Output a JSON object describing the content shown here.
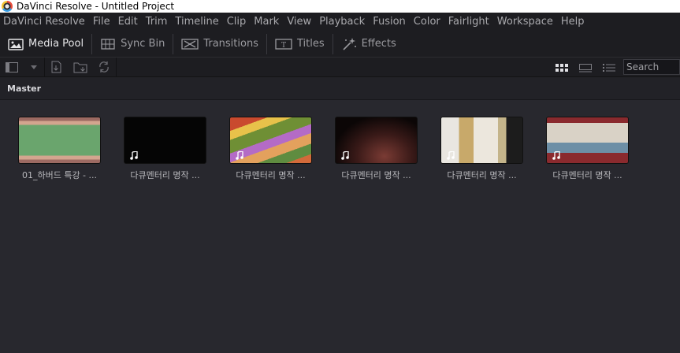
{
  "window": {
    "title": "DaVinci Resolve - Untitled Project"
  },
  "menu": [
    "DaVinci Resolve",
    "File",
    "Edit",
    "Trim",
    "Timeline",
    "Clip",
    "Mark",
    "View",
    "Playback",
    "Fusion",
    "Color",
    "Fairlight",
    "Workspace",
    "Help"
  ],
  "toolbar": {
    "media_pool": "Media Pool",
    "sync_bin": "Sync Bin",
    "transitions": "Transitions",
    "titles": "Titles",
    "effects": "Effects"
  },
  "search": {
    "placeholder": "Search"
  },
  "bin": {
    "name": "Master"
  },
  "clips": [
    {
      "label": "01_하버드 특강 - ...",
      "thumb": "green-stripes",
      "audio_icon": false
    },
    {
      "label": "다큐멘터리 명작 ...",
      "thumb": "black",
      "audio_icon": true
    },
    {
      "label": "다큐멘터리 명작 ...",
      "thumb": "anime-group",
      "audio_icon": true
    },
    {
      "label": "다큐멘터리 명작 ...",
      "thumb": "dark-red",
      "audio_icon": true
    },
    {
      "label": "다큐멘터리 명작 ...",
      "thumb": "anime-hands",
      "audio_icon": true
    },
    {
      "label": "다큐멘터리 명작 ...",
      "thumb": "anime-room",
      "audio_icon": true
    }
  ]
}
